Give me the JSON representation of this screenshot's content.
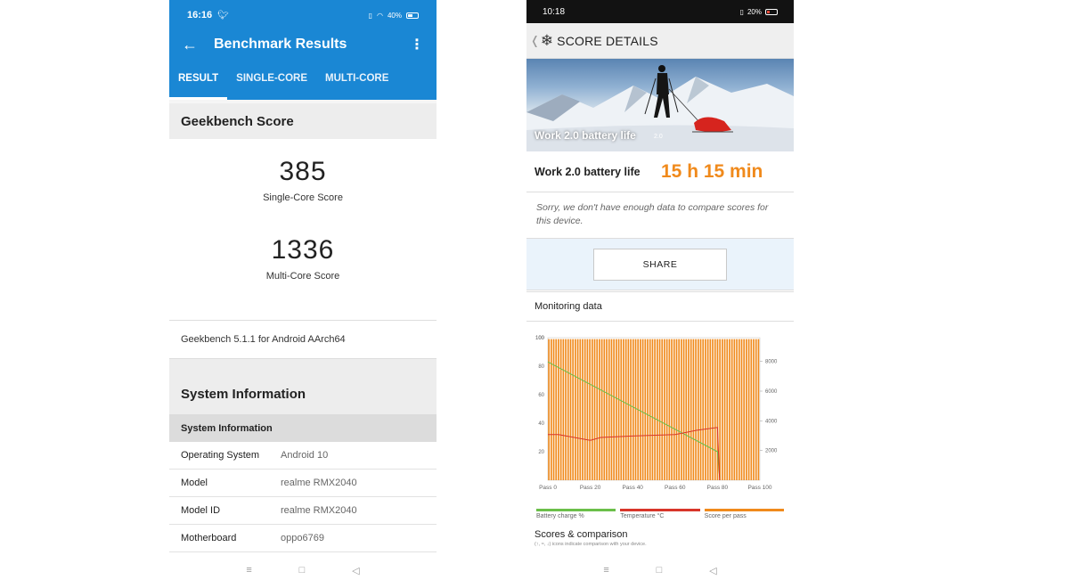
{
  "left": {
    "status": {
      "time": "16:16",
      "battery": "40%"
    },
    "appbar": {
      "title": "Benchmark Results"
    },
    "tabs": [
      {
        "label": "RESULT",
        "active": true
      },
      {
        "label": "SINGLE-CORE",
        "active": false
      },
      {
        "label": "MULTI-CORE",
        "active": false
      }
    ],
    "geekbench_heading": "Geekbench Score",
    "single_core": {
      "value": "385",
      "label": "Single-Core Score"
    },
    "multi_core": {
      "value": "1336",
      "label": "Multi-Core Score"
    },
    "version": "Geekbench 5.1.1 for Android AArch64",
    "sysinfo_heading": "System Information",
    "sysinfo_subheading": "System Information",
    "rows": [
      {
        "key": "Operating System",
        "value": "Android 10"
      },
      {
        "key": "Model",
        "value": "realme RMX2040"
      },
      {
        "key": "Model ID",
        "value": "realme RMX2040"
      },
      {
        "key": "Motherboard",
        "value": "oppo6769"
      }
    ]
  },
  "right": {
    "status": {
      "time": "10:18",
      "battery": "20%"
    },
    "header": {
      "title": "SCORE DETAILS"
    },
    "hero": {
      "caption": "Work 2.0 battery life",
      "version": "2.0"
    },
    "result": {
      "label": "Work 2.0 battery life",
      "value": "15 h 15 min"
    },
    "sorry": "Sorry, we don't have enough data to compare scores for this device.",
    "share_label": "SHARE",
    "monitoring_heading": "Monitoring data",
    "legend": [
      {
        "label": "Battery charge %",
        "color": "#6bbf4a"
      },
      {
        "label": "Temperature °C",
        "color": "#d8352a"
      },
      {
        "label": "Score per pass",
        "color": "#f08a1c"
      }
    ],
    "scores_heading": "Scores & comparison",
    "scores_note": "(↑, ≈, ↓) icons indicate comparison with your device."
  },
  "chart_data": {
    "type": "bar",
    "x_ticks": [
      "Pass 0",
      "Pass 20",
      "Pass 40",
      "Pass 60",
      "Pass 80",
      "Pass 100"
    ],
    "y_left_ticks": [
      20,
      40,
      60,
      80,
      100
    ],
    "y_right_ticks": [
      2000,
      4000,
      6000,
      8000
    ],
    "ylim_left": [
      0,
      100
    ],
    "series": [
      {
        "name": "Battery charge %",
        "x": [
          0,
          80,
          81
        ],
        "y": [
          83,
          20,
          2
        ]
      },
      {
        "name": "Temperature °C",
        "x": [
          0,
          5,
          20,
          25,
          40,
          60,
          70,
          80,
          81
        ],
        "y": [
          32,
          32,
          28,
          30,
          31,
          32,
          35,
          37,
          0
        ]
      },
      {
        "name": "Score per pass",
        "value": 99
      }
    ]
  }
}
